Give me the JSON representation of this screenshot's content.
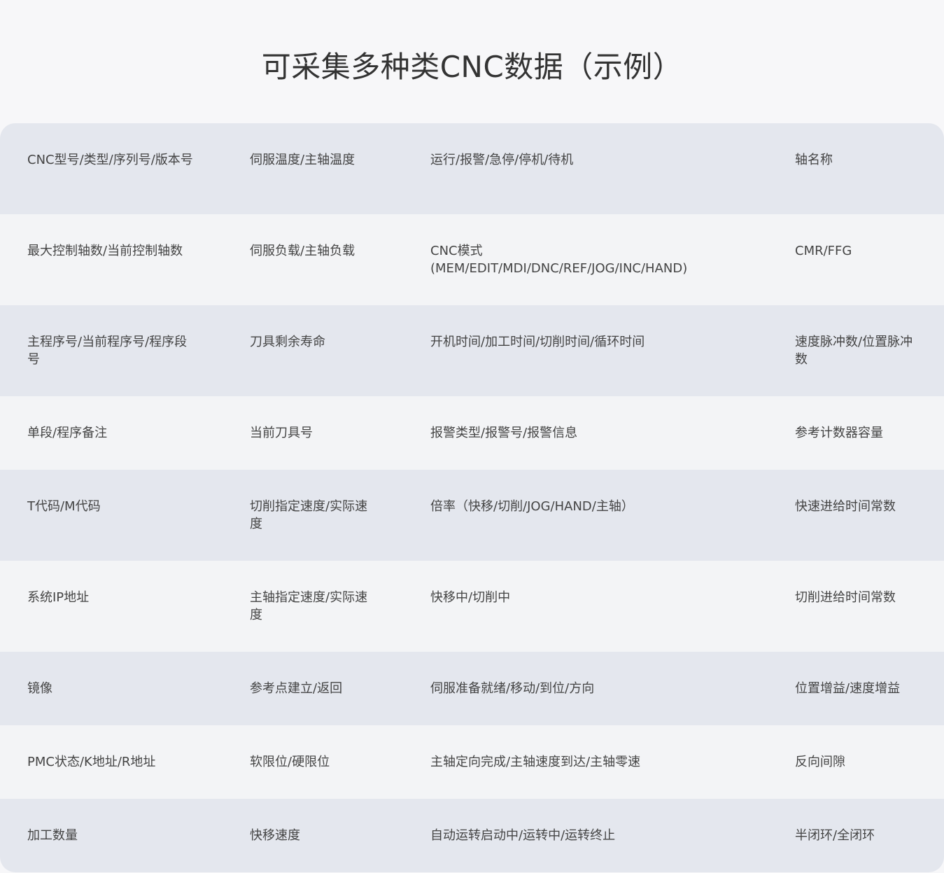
{
  "title": "可采集多种类CNC数据（示例）",
  "rows": [
    [
      "CNC型号/类型/序列号/版本号",
      "伺服温度/主轴温度",
      "运行/报警/急停/停机/待机",
      "轴名称"
    ],
    [
      "最大控制轴数/当前控制轴数",
      "伺服负载/主轴负载",
      "CNC模式(MEM/EDIT/MDI/DNC/REF/JOG/INC/HAND)",
      "CMR/FFG"
    ],
    [
      "主程序号/当前程序号/程序段号",
      "刀具剩余寿命",
      "开机时间/加工时间/切削时间/循环时间",
      "速度脉冲数/位置脉冲数"
    ],
    [
      "单段/程序备注",
      "当前刀具号",
      "报警类型/报警号/报警信息",
      "参考计数器容量"
    ],
    [
      "T代码/M代码",
      "切削指定速度/实际速度",
      "倍率（快移/切削/JOG/HAND/主轴）",
      "快速进给时间常数"
    ],
    [
      "系统IP地址",
      "主轴指定速度/实际速度",
      "快移中/切削中",
      "切削进给时间常数"
    ],
    [
      "镜像",
      "参考点建立/返回",
      "伺服准备就绪/移动/到位/方向",
      "位置增益/速度增益"
    ],
    [
      "PMC状态/K地址/R地址",
      "软限位/硬限位",
      "主轴定向完成/主轴速度到达/主轴零速",
      "反向间隙"
    ],
    [
      "加工数量",
      "快移速度",
      "自动运转启动中/运转中/运转终止",
      "半闭环/全闭环"
    ]
  ]
}
